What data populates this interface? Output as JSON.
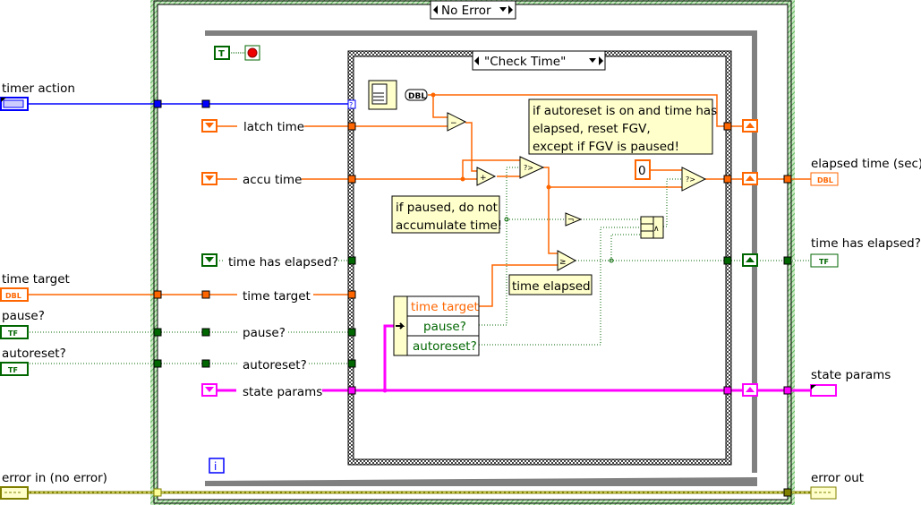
{
  "outer_case": {
    "selector": "No Error"
  },
  "inner_case": {
    "selector": "\"Check Time\""
  },
  "inputs": {
    "timer_action": "timer action",
    "time_target": "time target",
    "pause": "pause?",
    "autoreset": "autoreset?",
    "error_in": "error in (no error)"
  },
  "outputs": {
    "elapsed_time": "elapsed time (sec)",
    "time_has_elapsed": "time has elapsed?",
    "state_params": "state params",
    "error_out": "error out"
  },
  "loop_labels": {
    "latch_time": "latch time",
    "accu_time": "accu time",
    "time_has_elapsed": "time has elapsed?",
    "time_target": "time target",
    "pause": "pause?",
    "autoreset": "autoreset?",
    "state_params": "state params",
    "stop_constant": "T",
    "iteration": "i"
  },
  "unbundle": {
    "fields": [
      "time target",
      "pause?",
      "autoreset?"
    ]
  },
  "comments": {
    "autoreset": [
      "if autoreset is on and time has",
      "elapsed, reset FGV,",
      "except if FGV is paused!"
    ],
    "paused": [
      "if paused, do not",
      "accumulate time!"
    ],
    "time_elapsed": "time elapsed"
  },
  "constants": {
    "zero": "0",
    "dbl": "DBL",
    "tf": "TF"
  },
  "colors": {
    "dbl": "#ff6600",
    "bool": "#006600",
    "enum": "#0000ff",
    "cluster": "#ff00ff",
    "error": "#808000",
    "comment_bg": "#ffffcc"
  }
}
